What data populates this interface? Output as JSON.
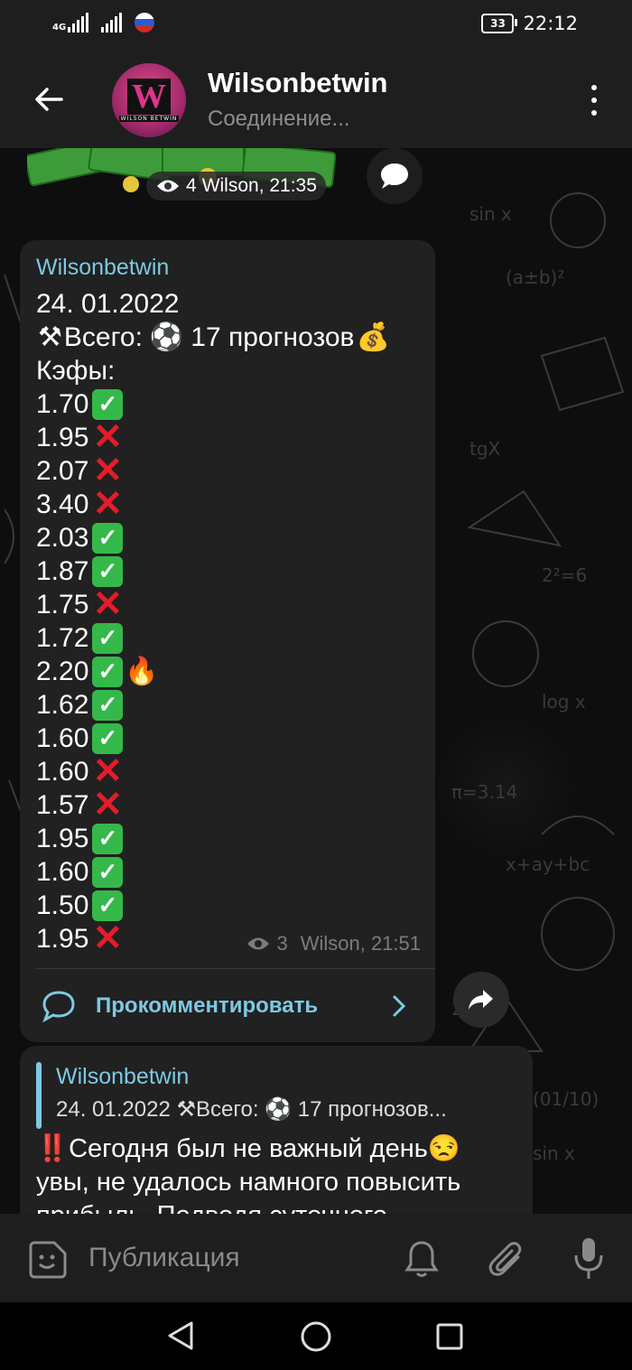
{
  "status_bar": {
    "network": "4G",
    "battery": "33",
    "time": "22:12"
  },
  "header": {
    "title": "Wilsonbetwin",
    "subtitle": "Соединение...",
    "avatar_letter": "W",
    "avatar_caption": "WILSON BETWIN"
  },
  "top_message": {
    "views": "4",
    "meta": "Wilson, 21:35"
  },
  "post": {
    "sender": "Wilsonbetwin",
    "date": "24. 01.2022",
    "summary_prefix": "Всего:",
    "summary_suffix": "17 прогнозов",
    "odds_label": "Кэфы:",
    "odds": [
      {
        "value": "1.70",
        "result": "win"
      },
      {
        "value": "1.95",
        "result": "loss"
      },
      {
        "value": "2.07",
        "result": "loss"
      },
      {
        "value": "3.40",
        "result": "loss"
      },
      {
        "value": "2.03",
        "result": "win"
      },
      {
        "value": "1.87",
        "result": "win"
      },
      {
        "value": "1.75",
        "result": "loss"
      },
      {
        "value": "1.72",
        "result": "win"
      },
      {
        "value": "2.20",
        "result": "win",
        "fire": true
      },
      {
        "value": "1.62",
        "result": "win"
      },
      {
        "value": "1.60",
        "result": "win"
      },
      {
        "value": "1.60",
        "result": "loss"
      },
      {
        "value": "1.57",
        "result": "loss"
      },
      {
        "value": "1.95",
        "result": "win"
      },
      {
        "value": "1.60",
        "result": "win"
      },
      {
        "value": "1.50",
        "result": "win"
      },
      {
        "value": "1.95",
        "result": "loss"
      }
    ],
    "views": "3",
    "meta": "Wilson, 21:51",
    "comment_label": "Прокомментировать"
  },
  "reply_post": {
    "reply_sender": "Wilsonbetwin",
    "reply_text": "24. 01.2022 ⚒Всего: ⚽ 17 прогнозов...",
    "line1": "‼️Сегодня был не важный день😒",
    "line2": "увы, не удалось намного повысить",
    "line3": "прибыль. Подводя суточного"
  },
  "input_bar": {
    "placeholder": "Публикация"
  },
  "colors": {
    "accent": "#7ec9e3",
    "win": "#35b84a",
    "loss": "#e51c2a",
    "bubble": "#212121"
  }
}
